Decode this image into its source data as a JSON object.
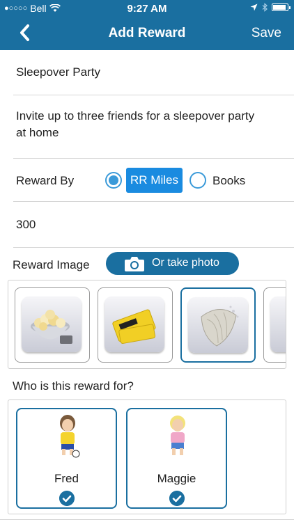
{
  "status": {
    "carrier": "Bell",
    "time": "9:27 AM"
  },
  "nav": {
    "title": "Add Reward",
    "save_label": "Save"
  },
  "form": {
    "name": "Sleepover Party",
    "description_line1": "Invite up to three friends for a sleepover party",
    "description_line2": "at home",
    "reward_by_label": "Reward By",
    "reward_by_options": [
      "RR Miles",
      "Books"
    ],
    "reward_by_selected": "RR Miles",
    "amount": "300",
    "reward_image_label": "Reward Image",
    "photo_button_label": "Or take photo"
  },
  "reward_images": [
    {
      "icon": "popcorn-icon",
      "selected": false
    },
    {
      "icon": "movie-ticket-icon",
      "selected": false
    },
    {
      "icon": "shell-icon",
      "selected": true
    }
  ],
  "who_label": "Who is this reward for?",
  "kids": [
    {
      "name": "Fred",
      "checked": true
    },
    {
      "name": "Maggie",
      "checked": true
    }
  ],
  "colors": {
    "accent": "#1a6fa0",
    "radio": "#3a9ad9",
    "chip": "#1a8be0"
  }
}
